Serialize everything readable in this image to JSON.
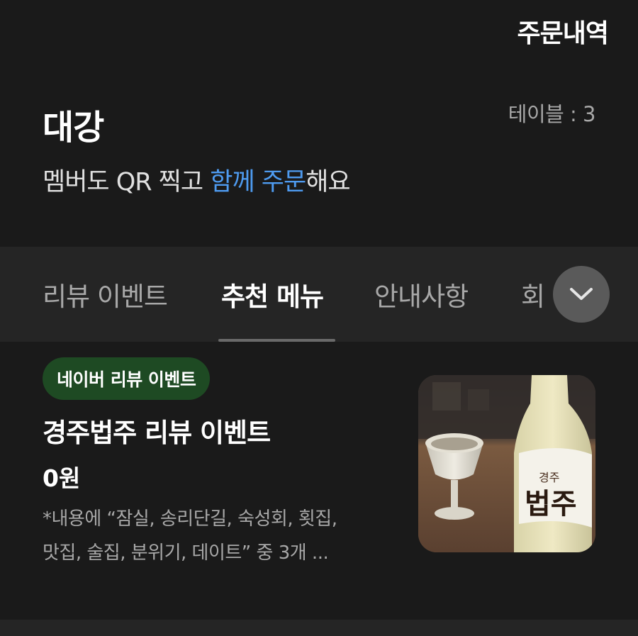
{
  "header": {
    "order_history": "주문내역",
    "store_name": "대강",
    "table_label": "테이블 : 3",
    "subtitle_prefix": "멤버도 QR 찍고 ",
    "subtitle_highlight": "함께 주문",
    "subtitle_suffix": "해요",
    "highlight_color": "#4e9bf0"
  },
  "tabs": [
    {
      "label": "리뷰 이벤트",
      "active": false
    },
    {
      "label": "추천 메뉴",
      "active": true
    },
    {
      "label": "안내사항",
      "active": false
    },
    {
      "label": "회",
      "active": false
    }
  ],
  "expand_icon": "chevron-down-icon",
  "item": {
    "badge": "네이버 리뷰 이벤트",
    "badge_color": "#1e4a23",
    "title": "경주법주 리뷰 이벤트",
    "price": "0원",
    "desc_line1": "*내용에 “잠실, 송리단길, 숙성회, 횟집,",
    "desc_line2": "맛집, 술집, 분위기, 데이트” 중 3개 ...",
    "image_label_top": "경주",
    "image_label_main": "법주"
  }
}
